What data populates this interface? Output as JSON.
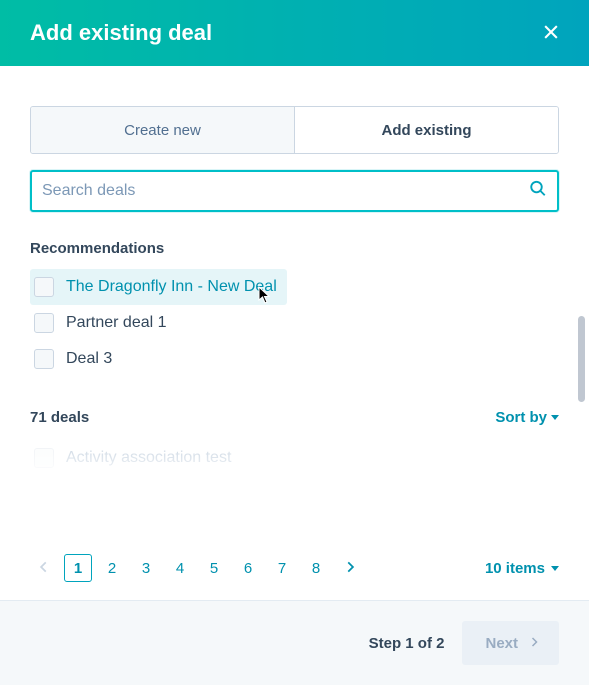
{
  "header": {
    "title": "Add existing deal"
  },
  "tabs": {
    "create": "Create new",
    "existing": "Add existing"
  },
  "search": {
    "placeholder": "Search deals",
    "value": ""
  },
  "recommendations": {
    "label": "Recommendations",
    "items": [
      {
        "label": "The Dragonfly Inn - New Deal",
        "highlight": true
      },
      {
        "label": "Partner deal 1",
        "highlight": false
      },
      {
        "label": "Deal 3",
        "highlight": false
      }
    ]
  },
  "deals": {
    "count_label": "71 deals",
    "sort_label": "Sort by",
    "peek_item": "Activity association test"
  },
  "pager": {
    "pages": [
      "1",
      "2",
      "3",
      "4",
      "5",
      "6",
      "7",
      "8"
    ],
    "current": "1",
    "items_label": "10 items"
  },
  "footer": {
    "step_label": "Step 1 of 2",
    "next_label": "Next"
  }
}
